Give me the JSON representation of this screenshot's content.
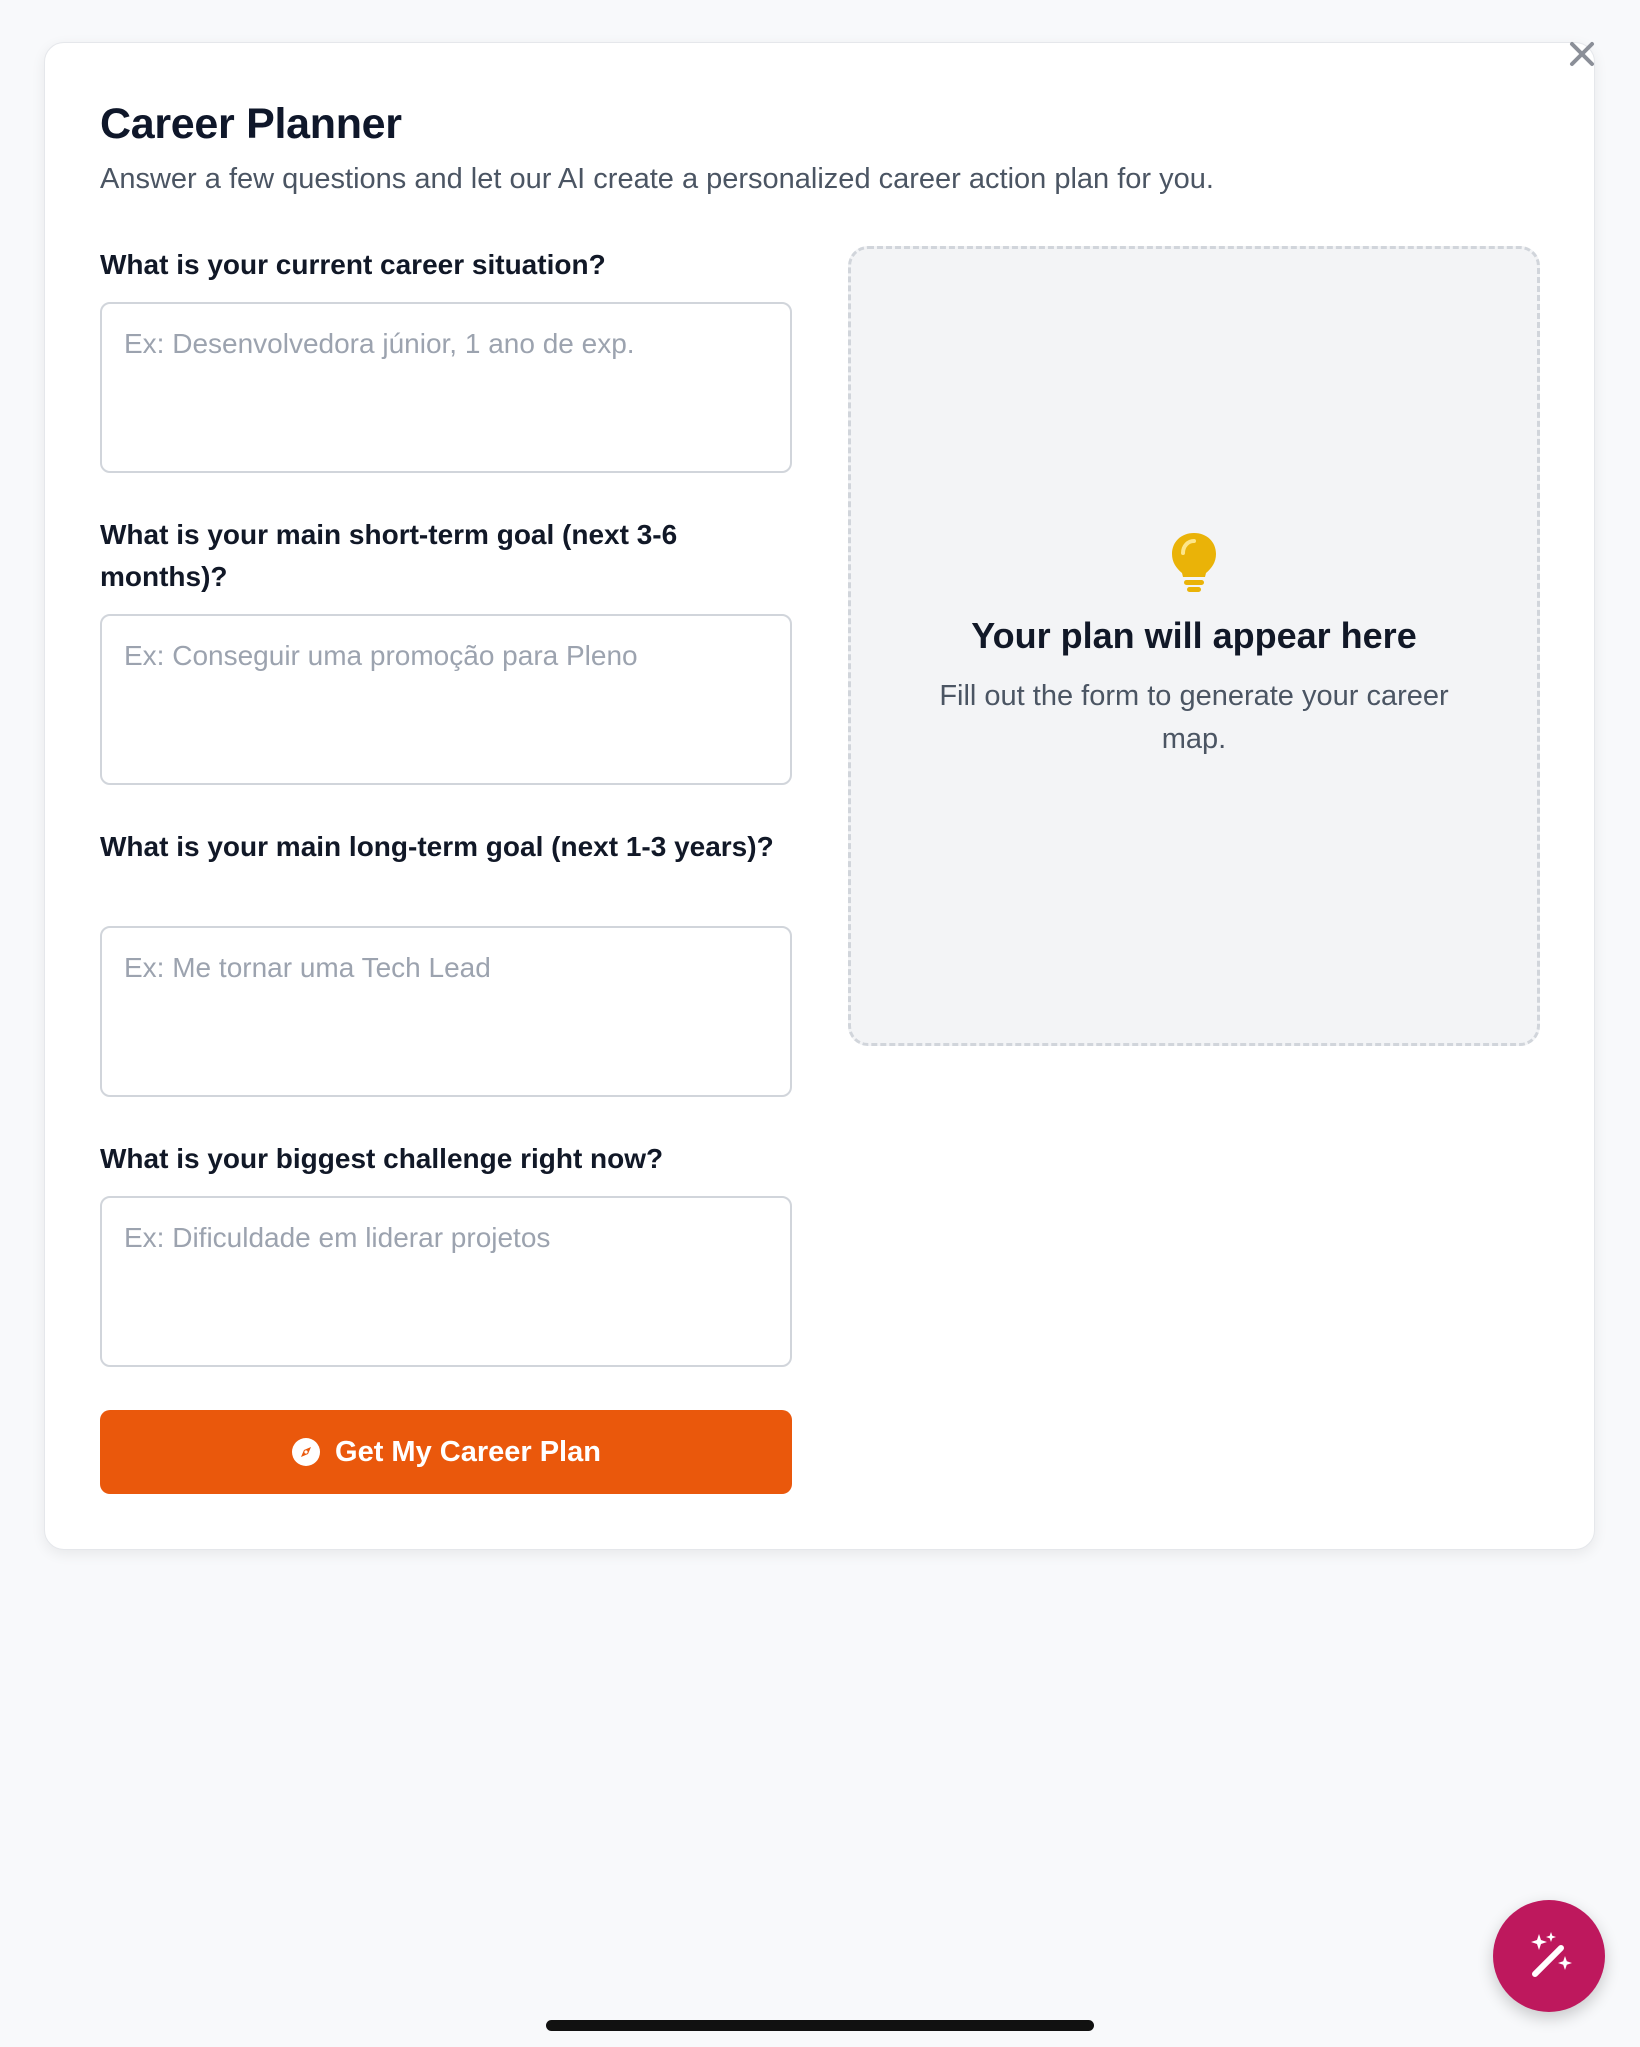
{
  "header": {
    "title": "Career Planner",
    "subtitle": "Answer a few questions and let our AI create a personalized career action plan for you."
  },
  "form": {
    "fields": [
      {
        "label": "What is your current career situation?",
        "value": "",
        "placeholder": "Ex: Desenvolvedora júnior, 1 ano de exp."
      },
      {
        "label": "What is your main short-term goal (next 3-6 months)?",
        "value": "",
        "placeholder": "Ex: Conseguir uma promoção para Pleno"
      },
      {
        "label": "What is your main long-term goal (next 1-3 years)?",
        "value": "",
        "placeholder": "Ex: Me tornar uma Tech Lead"
      },
      {
        "label": "What is your biggest challenge right now?",
        "value": "",
        "placeholder": "Ex: Dificuldade em liderar projetos"
      }
    ],
    "submit_label": "Get My Career Plan",
    "submit_icon": "compass-icon"
  },
  "result_panel": {
    "icon": "lightbulb-icon",
    "title": "Your plan will appear here",
    "text": "Fill out the form to generate your career map."
  },
  "close_icon": "close-icon",
  "fab_icon": "magic-wand-icon",
  "colors": {
    "accent": "#ea580c",
    "fab": "#be185d",
    "lightbulb": "#eab308",
    "page_background": "#f8f9fb",
    "panel_background": "#f3f4f6"
  }
}
